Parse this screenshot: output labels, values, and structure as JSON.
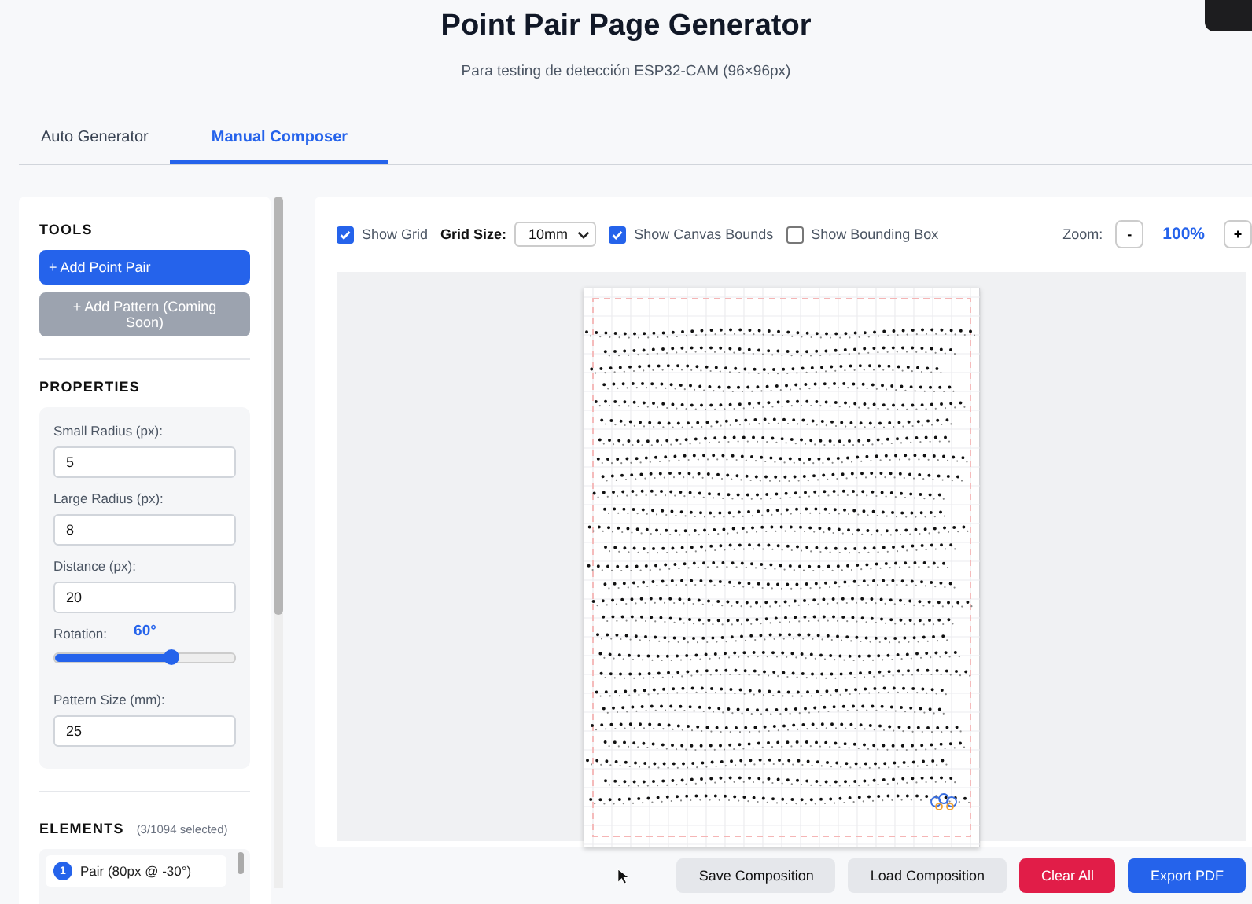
{
  "header": {
    "title": "Point Pair Page Generator",
    "subtitle": "Para testing de detección ESP32-CAM (96×96px)"
  },
  "tabs": [
    {
      "label": "Auto Generator",
      "selected": false
    },
    {
      "label": "Manual Composer",
      "selected": true
    }
  ],
  "tools": {
    "heading": "TOOLS",
    "buttons": [
      {
        "label": "+ Add Point Pair",
        "disabled": false
      },
      {
        "label": "+ Add Pattern (Coming Soon)",
        "disabled": true
      }
    ]
  },
  "properties": {
    "heading": "PROPERTIES",
    "fields": [
      {
        "kind": "input",
        "label": "Small Radius (px):",
        "value": "5"
      },
      {
        "kind": "input",
        "label": "Large Radius (px):",
        "value": "8"
      },
      {
        "kind": "input",
        "label": "Distance (px):",
        "value": "20"
      },
      {
        "kind": "slider",
        "label": "Rotation:",
        "reading": "60°",
        "level": 0.65
      },
      {
        "kind": "input",
        "label": "Pattern Size (mm):",
        "value": "25"
      }
    ]
  },
  "elements": {
    "heading": "ELEMENTS",
    "count": "(3/1094 selected)",
    "items": [
      {
        "index": "1",
        "label": "Pair (80px @ -30°)"
      }
    ]
  },
  "toolbar": {
    "options": [
      {
        "kind": "checkbox",
        "label": "Show Grid",
        "checked": true
      },
      {
        "kind": "select",
        "label": "Grid Size:",
        "value": "10mm"
      },
      {
        "kind": "checkbox",
        "label": "Show Canvas Bounds",
        "checked": true
      },
      {
        "kind": "checkbox",
        "label": "Show Bounding Box",
        "checked": false
      }
    ],
    "zoom": {
      "label": "Zoom:",
      "minus": "-",
      "value": "100%",
      "plus": "+"
    }
  },
  "actions": [
    {
      "label": "Save Composition",
      "kind": "secondary"
    },
    {
      "label": "Load Composition",
      "kind": "secondary"
    },
    {
      "label": "Clear All",
      "kind": "danger"
    },
    {
      "label": "Export PDF",
      "kind": "primary"
    }
  ]
}
